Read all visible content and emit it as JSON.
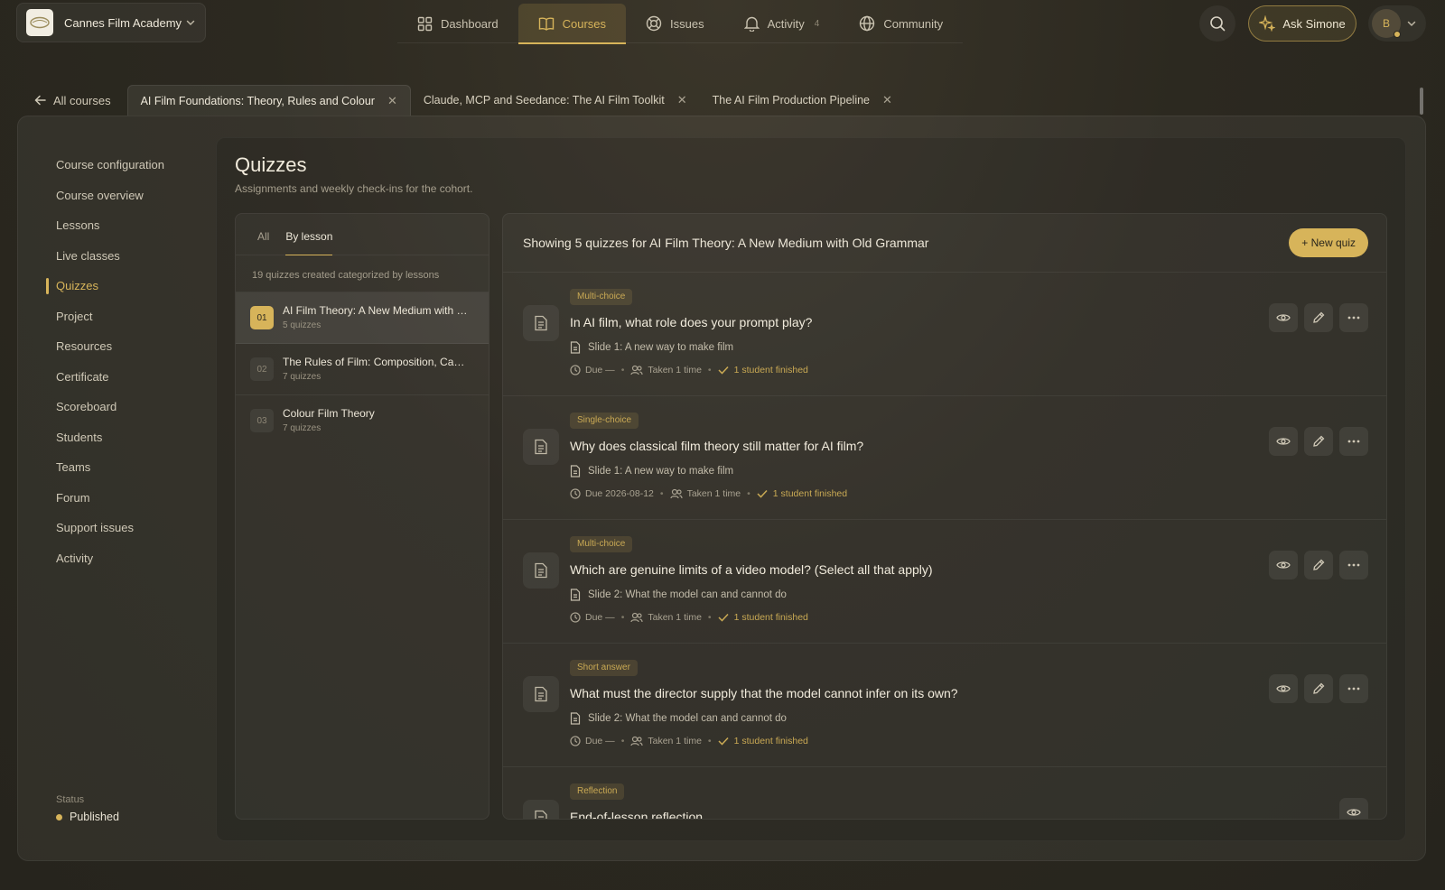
{
  "brand": {
    "name": "Cannes Film Academy"
  },
  "nav": [
    {
      "label": "Dashboard",
      "icon": "grid-icon"
    },
    {
      "label": "Courses",
      "icon": "book-icon",
      "active": true
    },
    {
      "label": "Issues",
      "icon": "lifebuoy-icon"
    },
    {
      "label": "Activity",
      "icon": "bell-icon",
      "badge": "4"
    },
    {
      "label": "Community",
      "icon": "globe-icon"
    }
  ],
  "header": {
    "ask_label": "Ask Simone",
    "avatar_initial": "B"
  },
  "tabs": {
    "back_label": "All courses",
    "courses": [
      {
        "label": "AI Film Foundations: Theory, Rules and Colour",
        "active": true
      },
      {
        "label": "Claude, MCP and Seedance: The AI Film Toolkit"
      },
      {
        "label": "The AI Film Production Pipeline"
      }
    ]
  },
  "sidebar": {
    "items": [
      "Course configuration",
      "Course overview",
      "Lessons",
      "Live classes",
      "Quizzes",
      "Project",
      "Resources",
      "Certificate",
      "Scoreboard",
      "Students",
      "Teams",
      "Forum",
      "Support issues",
      "Activity"
    ],
    "active_index": 4,
    "status_label": "Status",
    "status_value": "Published"
  },
  "page": {
    "title": "Quizzes",
    "subtitle": "Assignments and weekly check-ins for the cohort."
  },
  "lessons_panel": {
    "filters": [
      "All",
      "By lesson"
    ],
    "active_filter": 1,
    "summary": "19 quizzes created categorized by lessons",
    "lessons": [
      {
        "num": "01",
        "title": "AI Film Theory: A New Medium with Old Grammar",
        "count": "5 quizzes",
        "active": true
      },
      {
        "num": "02",
        "title": "The Rules of Film: Composition, Camera and Continuity",
        "count": "7 quizzes"
      },
      {
        "num": "03",
        "title": "Colour Film Theory",
        "count": "7 quizzes"
      }
    ]
  },
  "quiz_panel": {
    "heading": "Showing 5 quizzes for AI Film Theory: A New Medium with Old Grammar",
    "new_quiz_label": "+ New quiz",
    "quizzes": [
      {
        "type": "Multi-choice",
        "title": "In AI film, what role does your prompt play?",
        "slide": "Slide 1: A new way to make film",
        "due": "Due —",
        "taken": "Taken 1 time",
        "finished": "1 student finished"
      },
      {
        "type": "Single-choice",
        "title": "Why does classical film theory still matter for AI film?",
        "slide": "Slide 1: A new way to make film",
        "due": "Due 2026-08-12",
        "taken": "Taken 1 time",
        "finished": "1 student finished"
      },
      {
        "type": "Multi-choice",
        "title": "Which are genuine limits of a video model? (Select all that apply)",
        "slide": "Slide 2: What the model can and cannot do",
        "due": "Due —",
        "taken": "Taken 1 time",
        "finished": "1 student finished"
      },
      {
        "type": "Short answer",
        "title": "What must the director supply that the model cannot infer on its own?",
        "slide": "Slide 2: What the model can and cannot do",
        "due": "Due —",
        "taken": "Taken 1 time",
        "finished": "1 student finished"
      },
      {
        "type": "Reflection",
        "title": "End-of-lesson reflection"
      }
    ]
  },
  "colors": {
    "accent": "#d7b45a",
    "background": "#2c2920"
  }
}
